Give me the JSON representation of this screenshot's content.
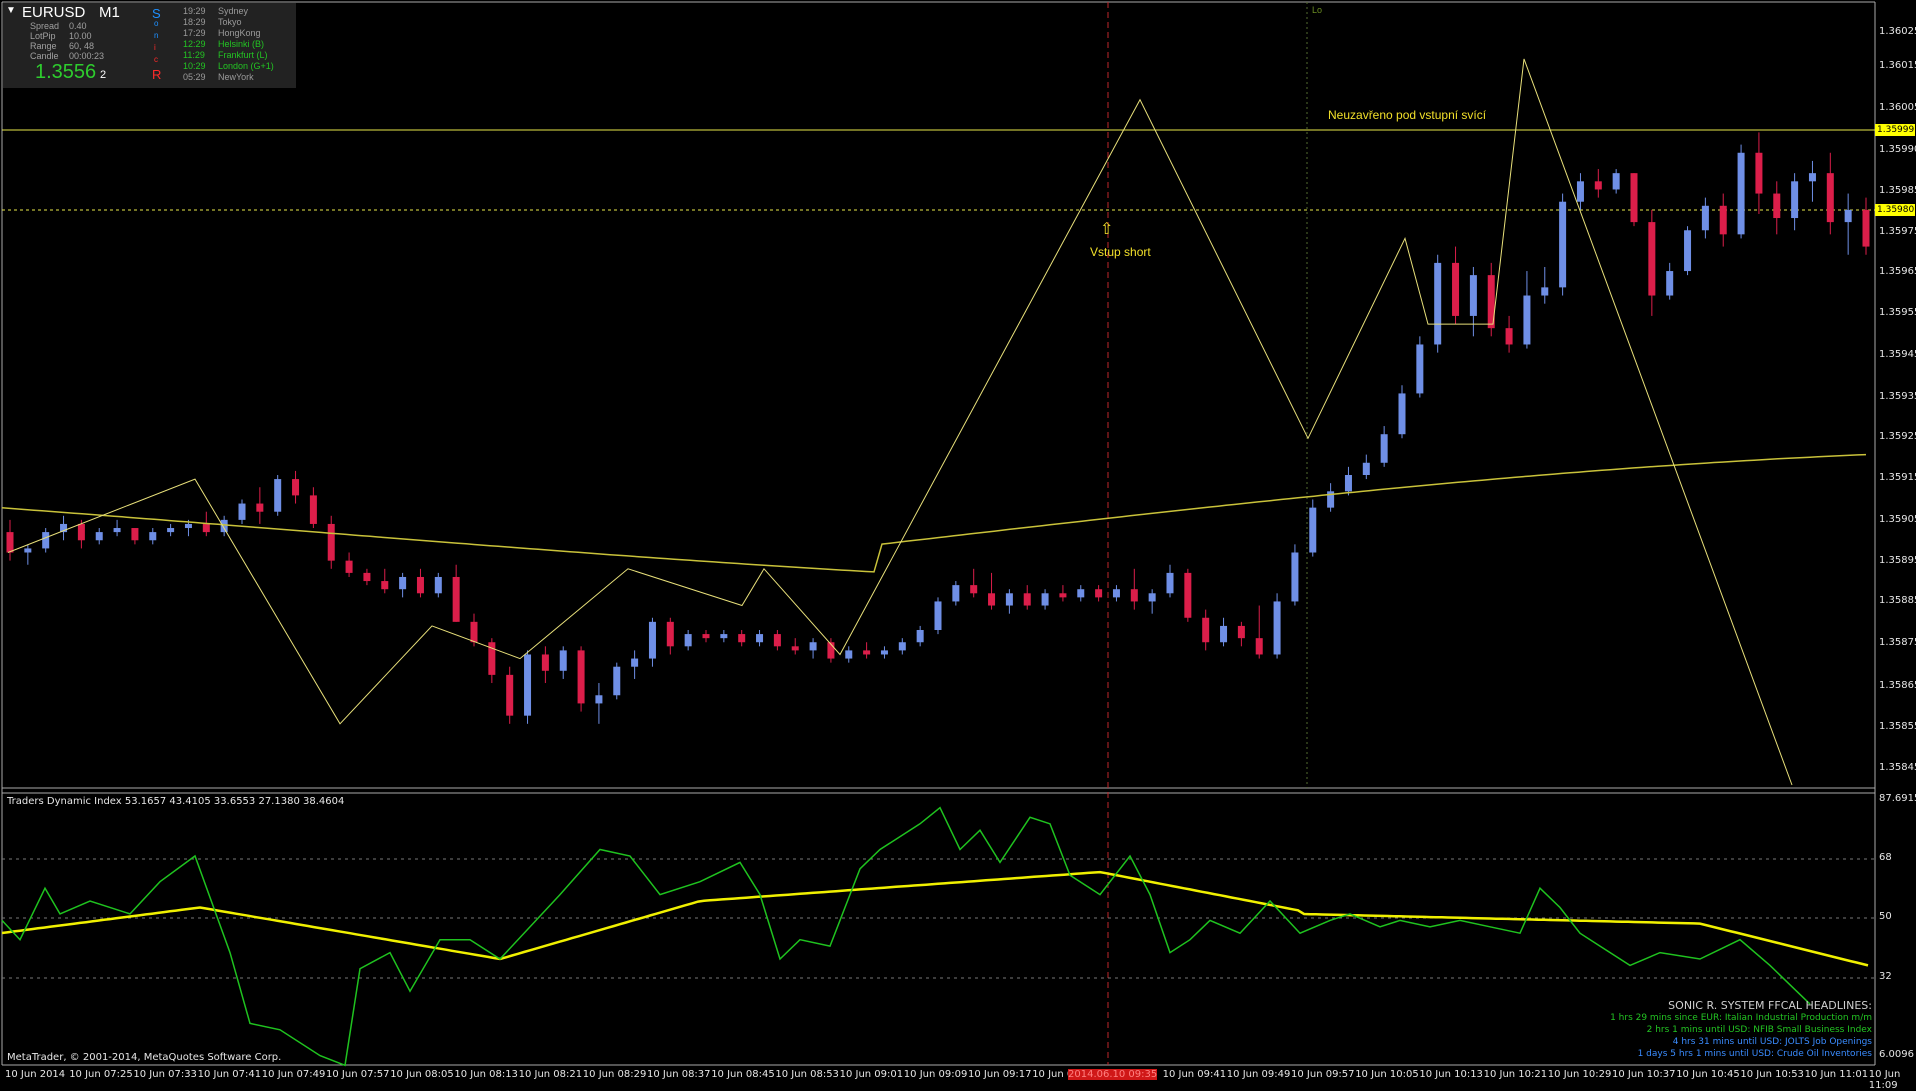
{
  "window": {
    "symbol": "EURUSD",
    "timeframe": "M1",
    "menu_glyph": "▼"
  },
  "info_panel": {
    "rows": [
      {
        "label": "Spread",
        "value": "0.40"
      },
      {
        "label": "LotPip",
        "value": "10.00"
      },
      {
        "label": "Range",
        "value": "60, 48"
      },
      {
        "label": "Candle",
        "value": "00:00:23"
      }
    ],
    "price_big": "1.3556",
    "price_small": "2",
    "sonic_letters": [
      "S",
      "o",
      "n",
      "i",
      "c",
      "R"
    ],
    "sonic_colors": [
      "#1e90ff",
      "#1e90ff",
      "#1e90ff",
      "#ff2a2a",
      "#ff2a2a",
      "#ff2a2a"
    ],
    "sessions": [
      {
        "time": "19:29",
        "name": "Sydney",
        "color": "#9a9a9a"
      },
      {
        "time": "18:29",
        "name": "Tokyo",
        "color": "#9a9a9a"
      },
      {
        "time": "17:29",
        "name": "HongKong",
        "color": "#9a9a9a"
      },
      {
        "time": "12:29",
        "name": "Helsinki  (B)",
        "color": "#23c423"
      },
      {
        "time": "11:29",
        "name": "Frankfurt  (L)",
        "color": "#23c423"
      },
      {
        "time": "10:29",
        "name": "London  (G+1)",
        "color": "#23c423"
      },
      {
        "time": "05:29",
        "name": "NewYork",
        "color": "#9a9a9a"
      }
    ]
  },
  "annotations": {
    "neuzavreno": "Neuzavřeno pod vstupní svící",
    "vstup": "Vstup short",
    "arrow": "⇧",
    "lo": "Lo"
  },
  "price_axis": {
    "labels": [
      "1.36025",
      "1.36015",
      "1.36005",
      "1.35990",
      "1.35985",
      "1.35975",
      "1.35965",
      "1.35955",
      "1.35945",
      "1.35935",
      "1.35925",
      "1.35915",
      "1.35905",
      "1.35895",
      "1.35885",
      "1.35875",
      "1.35865",
      "1.35855",
      "1.35845"
    ],
    "level_high": "1.35999",
    "level_low": "1.35980"
  },
  "indicator": {
    "title": "Traders Dynamic Index 53.1657 43.4105 33.6553 27.1380 38.4604",
    "axis_labels": [
      "87.6915",
      "68",
      "50",
      "32",
      "6.0096"
    ]
  },
  "time_axis": {
    "labels": [
      "10 Jun 2014",
      "10 Jun 07:25",
      "10 Jun 07:33",
      "10 Jun 07:41",
      "10 Jun 07:49",
      "10 Jun 07:57",
      "10 Jun 08:05",
      "10 Jun 08:13",
      "10 Jun 08:21",
      "10 Jun 08:29",
      "10 Jun 08:37",
      "10 Jun 08:45",
      "10 Jun 08:53",
      "10 Jun 09:01",
      "10 Jun 09:09",
      "10 Jun 09:17",
      "10 Jun 09",
      "2014.06.10 09:35",
      "10 Jun 09:41",
      "10 Jun 09:49",
      "10 Jun 09:57",
      "10 Jun 10:05",
      "10 Jun 10:13",
      "10 Jun 10:21",
      "10 Jun 10:29",
      "10 Jun 10:37",
      "10 Jun 10:45",
      "10 Jun 10:53",
      "10 Jun 11:01",
      "10 Jun 11:09"
    ],
    "highlight_index": 17
  },
  "headlines": {
    "title": "SONIC R. SYSTEM  FFCAL HEADLINES:",
    "items": [
      {
        "text": "1 hrs 29 mins since EUR: Italian Industrial Production m/m",
        "color": "#23c423"
      },
      {
        "text": "2 hrs 1 mins until USD: NFIB Small Business Index",
        "color": "#23c423"
      },
      {
        "text": "4 hrs 31 mins until USD: JOLTS Job Openings",
        "color": "#3a8cff"
      },
      {
        "text": "1 days 5 hrs 1 mins until USD: Crude Oil Inventories",
        "color": "#3a8cff"
      }
    ]
  },
  "copyright": "MetaTrader, © 2001-2014, MetaQuotes Software Corp.",
  "colors": {
    "bull": "#6f8fe6",
    "bear": "#dc1e4a",
    "zigzag": "#e8e07a",
    "ema": "#c9c23a",
    "level": "#e9e94a",
    "tdi_green": "#1fc21f",
    "tdi_yellow": "#f0f000"
  },
  "chart_data": {
    "type": "candlestick",
    "symbol": "EURUSD",
    "timeframe": "M1",
    "candles_ohlc": [
      [
        1.35902,
        1.35905,
        1.35895,
        1.35897
      ],
      [
        1.35897,
        1.35899,
        1.35894,
        1.35898
      ],
      [
        1.35898,
        1.35903,
        1.35897,
        1.35902
      ],
      [
        1.35902,
        1.35906,
        1.359,
        1.35904
      ],
      [
        1.35904,
        1.35905,
        1.35898,
        1.359
      ],
      [
        1.359,
        1.35903,
        1.35899,
        1.35902
      ],
      [
        1.35902,
        1.35905,
        1.35901,
        1.35903
      ],
      [
        1.35903,
        1.35903,
        1.35899,
        1.359
      ],
      [
        1.359,
        1.35903,
        1.35899,
        1.35902
      ],
      [
        1.35902,
        1.35904,
        1.35901,
        1.35903
      ],
      [
        1.35903,
        1.35905,
        1.35901,
        1.35904
      ],
      [
        1.35904,
        1.35907,
        1.35901,
        1.35902
      ],
      [
        1.35902,
        1.35906,
        1.35901,
        1.35905
      ],
      [
        1.35905,
        1.3591,
        1.35904,
        1.35909
      ],
      [
        1.35909,
        1.35913,
        1.35904,
        1.35907
      ],
      [
        1.35907,
        1.35916,
        1.35906,
        1.35915
      ],
      [
        1.35915,
        1.35917,
        1.35909,
        1.35911
      ],
      [
        1.35911,
        1.35913,
        1.35903,
        1.35904
      ],
      [
        1.35904,
        1.35906,
        1.35893,
        1.35895
      ],
      [
        1.35895,
        1.35897,
        1.35891,
        1.35892
      ],
      [
        1.35892,
        1.35893,
        1.35889,
        1.3589
      ],
      [
        1.3589,
        1.35893,
        1.35887,
        1.35888
      ],
      [
        1.35888,
        1.35892,
        1.35886,
        1.35891
      ],
      [
        1.35891,
        1.35893,
        1.35886,
        1.35887
      ],
      [
        1.35887,
        1.35892,
        1.35886,
        1.35891
      ],
      [
        1.35891,
        1.35894,
        1.3588,
        1.3588
      ],
      [
        1.3588,
        1.35882,
        1.35874,
        1.35875
      ],
      [
        1.35875,
        1.35876,
        1.35865,
        1.35867
      ],
      [
        1.35867,
        1.35869,
        1.35855,
        1.35857
      ],
      [
        1.35857,
        1.35873,
        1.35855,
        1.35872
      ],
      [
        1.35872,
        1.35874,
        1.35865,
        1.35868
      ],
      [
        1.35868,
        1.35874,
        1.35866,
        1.35873
      ],
      [
        1.35873,
        1.35874,
        1.35858,
        1.3586
      ],
      [
        1.3586,
        1.35865,
        1.35855,
        1.35862
      ],
      [
        1.35862,
        1.3587,
        1.35861,
        1.35869
      ],
      [
        1.35869,
        1.35873,
        1.35866,
        1.35871
      ],
      [
        1.35871,
        1.35881,
        1.35869,
        1.3588
      ],
      [
        1.3588,
        1.35881,
        1.35872,
        1.35874
      ],
      [
        1.35874,
        1.35878,
        1.35873,
        1.35877
      ],
      [
        1.35877,
        1.35878,
        1.35875,
        1.35876
      ],
      [
        1.35876,
        1.35878,
        1.35875,
        1.35877
      ],
      [
        1.35877,
        1.35878,
        1.35874,
        1.35875
      ],
      [
        1.35875,
        1.35878,
        1.35874,
        1.35877
      ],
      [
        1.35877,
        1.35878,
        1.35873,
        1.35874
      ],
      [
        1.35874,
        1.35876,
        1.35872,
        1.35873
      ],
      [
        1.35873,
        1.35876,
        1.35871,
        1.35875
      ],
      [
        1.35875,
        1.35876,
        1.3587,
        1.35871
      ],
      [
        1.35871,
        1.35874,
        1.3587,
        1.35873
      ],
      [
        1.35873,
        1.35875,
        1.35871,
        1.35872
      ],
      [
        1.35872,
        1.35874,
        1.35871,
        1.35873
      ],
      [
        1.35873,
        1.35876,
        1.35872,
        1.35875
      ],
      [
        1.35875,
        1.35879,
        1.35874,
        1.35878
      ],
      [
        1.35878,
        1.35886,
        1.35877,
        1.35885
      ],
      [
        1.35885,
        1.3589,
        1.35884,
        1.35889
      ],
      [
        1.35889,
        1.35893,
        1.35886,
        1.35887
      ],
      [
        1.35887,
        1.35892,
        1.35883,
        1.35884
      ],
      [
        1.35884,
        1.35888,
        1.35882,
        1.35887
      ],
      [
        1.35887,
        1.35889,
        1.35883,
        1.35884
      ],
      [
        1.35884,
        1.35888,
        1.35883,
        1.35887
      ],
      [
        1.35887,
        1.35889,
        1.35885,
        1.35886
      ],
      [
        1.35886,
        1.35889,
        1.35885,
        1.35888
      ],
      [
        1.35888,
        1.35889,
        1.35885,
        1.35886
      ],
      [
        1.35886,
        1.35889,
        1.35885,
        1.35888
      ],
      [
        1.35888,
        1.35893,
        1.35883,
        1.35885
      ],
      [
        1.35885,
        1.35888,
        1.35882,
        1.35887
      ],
      [
        1.35887,
        1.35894,
        1.35886,
        1.35892
      ],
      [
        1.35892,
        1.35893,
        1.3588,
        1.35881
      ],
      [
        1.35881,
        1.35883,
        1.35873,
        1.35875
      ],
      [
        1.35875,
        1.35881,
        1.35874,
        1.35879
      ],
      [
        1.35879,
        1.3588,
        1.35874,
        1.35876
      ],
      [
        1.35876,
        1.35884,
        1.35871,
        1.35872
      ],
      [
        1.35872,
        1.35887,
        1.35871,
        1.35885
      ],
      [
        1.35885,
        1.35899,
        1.35884,
        1.35897
      ],
      [
        1.35897,
        1.3591,
        1.35896,
        1.35908
      ],
      [
        1.35908,
        1.35914,
        1.35907,
        1.35912
      ],
      [
        1.35912,
        1.35918,
        1.35911,
        1.35916
      ],
      [
        1.35916,
        1.35921,
        1.35915,
        1.35919
      ],
      [
        1.35919,
        1.35928,
        1.35918,
        1.35926
      ],
      [
        1.35926,
        1.35938,
        1.35925,
        1.35936
      ],
      [
        1.35936,
        1.3595,
        1.35935,
        1.35948
      ],
      [
        1.35948,
        1.3597,
        1.35946,
        1.35968
      ],
      [
        1.35968,
        1.35972,
        1.35953,
        1.35955
      ],
      [
        1.35955,
        1.35967,
        1.3595,
        1.35965
      ],
      [
        1.35965,
        1.35968,
        1.3595,
        1.35952
      ],
      [
        1.35952,
        1.35955,
        1.35946,
        1.35948
      ],
      [
        1.35948,
        1.35966,
        1.35947,
        1.3596
      ],
      [
        1.3596,
        1.35967,
        1.35958,
        1.35962
      ],
      [
        1.35962,
        1.35985,
        1.3596,
        1.35983
      ],
      [
        1.35983,
        1.3599,
        1.35981,
        1.35988
      ],
      [
        1.35988,
        1.35991,
        1.35984,
        1.35986
      ],
      [
        1.35986,
        1.35991,
        1.35985,
        1.3599
      ],
      [
        1.3599,
        1.3599,
        1.35977,
        1.35978
      ],
      [
        1.35978,
        1.35981,
        1.35955,
        1.3596
      ],
      [
        1.3596,
        1.35968,
        1.35959,
        1.35966
      ],
      [
        1.35966,
        1.35977,
        1.35965,
        1.35976
      ],
      [
        1.35976,
        1.35984,
        1.35974,
        1.35982
      ],
      [
        1.35982,
        1.35985,
        1.35972,
        1.35975
      ],
      [
        1.35975,
        1.35997,
        1.35974,
        1.35995
      ],
      [
        1.35995,
        1.36,
        1.3598,
        1.35985
      ],
      [
        1.35985,
        1.35988,
        1.35975,
        1.35979
      ],
      [
        1.35979,
        1.3599,
        1.35976,
        1.35988
      ],
      [
        1.35988,
        1.35993,
        1.35983,
        1.3599
      ],
      [
        1.3599,
        1.35995,
        1.35975,
        1.35978
      ],
      [
        1.35978,
        1.35985,
        1.3597,
        1.35981
      ],
      [
        1.35981,
        1.35984,
        1.3597,
        1.35972
      ]
    ],
    "ema_level": 1.35903,
    "zigzag_prices": [
      1.35897,
      1.35915,
      1.35855,
      1.35879,
      1.35871,
      1.35893,
      1.35884,
      1.35893,
      1.35872,
      1.36008,
      1.35925,
      1.35974,
      1.35953,
      1.35953,
      1.36018,
      1.3584
    ],
    "horizontal_levels": [
      1.35999,
      1.3598
    ],
    "y_range": [
      1.3584,
      1.3603
    ],
    "indicator_range": [
      6.0096,
      87.6915
    ],
    "indicator_levels": [
      68,
      50,
      32
    ]
  }
}
